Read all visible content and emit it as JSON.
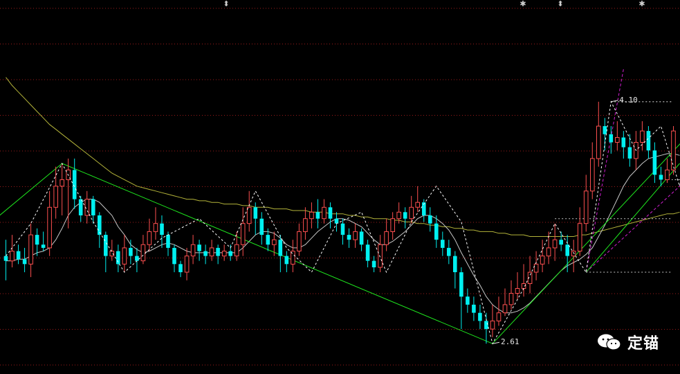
{
  "chart_data": {
    "type": "candlestick",
    "y_range": [
      2.5,
      4.3
    ],
    "labels": {
      "low": "2.61",
      "high": "4.10"
    },
    "candles": [
      [
        3.15,
        3.12,
        3.25,
        3.0
      ],
      [
        3.12,
        3.18,
        3.28,
        3.08
      ],
      [
        3.18,
        3.13,
        3.22,
        3.1
      ],
      [
        3.13,
        3.1,
        3.2,
        3.05
      ],
      [
        3.1,
        3.28,
        3.35,
        3.02
      ],
      [
        3.28,
        3.22,
        3.32,
        3.15
      ],
      [
        3.22,
        3.2,
        3.3,
        3.18
      ],
      [
        3.2,
        3.45,
        3.55,
        3.15
      ],
      [
        3.45,
        3.58,
        3.7,
        3.38
      ],
      [
        3.58,
        3.62,
        3.72,
        3.4
      ],
      [
        3.62,
        3.68,
        3.75,
        3.32
      ],
      [
        3.68,
        3.5,
        3.75,
        3.44
      ],
      [
        3.5,
        3.4,
        3.52,
        3.36
      ],
      [
        3.4,
        3.5,
        3.55,
        3.35
      ],
      [
        3.5,
        3.4,
        3.52,
        3.35
      ],
      [
        3.4,
        3.28,
        3.42,
        3.2
      ],
      [
        3.28,
        3.15,
        3.3,
        3.05
      ],
      [
        3.15,
        3.18,
        3.25,
        3.12
      ],
      [
        3.18,
        3.1,
        3.22,
        3.05
      ],
      [
        3.1,
        3.2,
        3.28,
        3.05
      ],
      [
        3.2,
        3.15,
        3.25,
        3.1
      ],
      [
        3.15,
        3.12,
        3.2,
        3.05
      ],
      [
        3.12,
        3.22,
        3.28,
        3.1
      ],
      [
        3.22,
        3.3,
        3.38,
        3.18
      ],
      [
        3.3,
        3.35,
        3.45,
        3.25
      ],
      [
        3.35,
        3.28,
        3.4,
        3.2
      ],
      [
        3.28,
        3.2,
        3.3,
        3.15
      ],
      [
        3.2,
        3.1,
        3.22,
        3.05
      ],
      [
        3.1,
        3.05,
        3.12,
        3.02
      ],
      [
        3.05,
        3.15,
        3.2,
        3.0
      ],
      [
        3.15,
        3.22,
        3.28,
        3.1
      ],
      [
        3.22,
        3.18,
        3.25,
        3.12
      ],
      [
        3.18,
        3.15,
        3.22,
        3.1
      ],
      [
        3.15,
        3.2,
        3.25,
        3.12
      ],
      [
        3.2,
        3.15,
        3.22,
        3.1
      ],
      [
        3.15,
        3.18,
        3.22,
        3.12
      ],
      [
        3.18,
        3.15,
        3.22,
        3.12
      ],
      [
        3.15,
        3.22,
        3.3,
        3.12
      ],
      [
        3.22,
        3.35,
        3.45,
        3.15
      ],
      [
        3.35,
        3.45,
        3.55,
        3.3
      ],
      [
        3.45,
        3.38,
        3.48,
        3.28
      ],
      [
        3.38,
        3.28,
        3.42,
        3.22
      ],
      [
        3.28,
        3.22,
        3.32,
        3.18
      ],
      [
        3.22,
        3.25,
        3.3,
        3.15
      ],
      [
        3.25,
        3.15,
        3.28,
        3.05
      ],
      [
        3.15,
        3.1,
        3.18,
        3.05
      ],
      [
        3.1,
        3.18,
        3.25,
        3.05
      ],
      [
        3.18,
        3.3,
        3.35,
        3.15
      ],
      [
        3.3,
        3.38,
        3.45,
        3.25
      ],
      [
        3.38,
        3.42,
        3.48,
        3.32
      ],
      [
        3.42,
        3.38,
        3.5,
        3.32
      ],
      [
        3.38,
        3.45,
        3.5,
        3.35
      ],
      [
        3.45,
        3.38,
        3.48,
        3.32
      ],
      [
        3.38,
        3.35,
        3.42,
        3.3
      ],
      [
        3.35,
        3.28,
        3.38,
        3.22
      ],
      [
        3.28,
        3.25,
        3.32,
        3.2
      ],
      [
        3.25,
        3.3,
        3.35,
        3.2
      ],
      [
        3.3,
        3.22,
        3.32,
        3.18
      ],
      [
        3.22,
        3.12,
        3.25,
        3.08
      ],
      [
        3.12,
        3.08,
        3.15,
        3.05
      ],
      [
        3.08,
        3.22,
        3.28,
        3.05
      ],
      [
        3.22,
        3.3,
        3.38,
        3.18
      ],
      [
        3.3,
        3.38,
        3.42,
        3.25
      ],
      [
        3.38,
        3.42,
        3.48,
        3.35
      ],
      [
        3.42,
        3.38,
        3.45,
        3.32
      ],
      [
        3.38,
        3.45,
        3.52,
        3.35
      ],
      [
        3.45,
        3.48,
        3.58,
        3.42
      ],
      [
        3.48,
        3.4,
        3.5,
        3.36
      ],
      [
        3.4,
        3.35,
        3.45,
        3.3
      ],
      [
        3.35,
        3.25,
        3.4,
        3.2
      ],
      [
        3.25,
        3.2,
        3.3,
        3.15
      ],
      [
        3.2,
        3.15,
        3.25,
        3.1
      ],
      [
        3.15,
        3.05,
        3.18,
        2.95
      ],
      [
        3.05,
        2.9,
        3.08,
        2.7
      ],
      [
        2.9,
        2.85,
        2.95,
        2.8
      ],
      [
        2.85,
        2.8,
        2.9,
        2.75
      ],
      [
        2.8,
        2.75,
        2.85,
        2.7
      ],
      [
        2.75,
        2.7,
        2.8,
        2.61
      ],
      [
        2.7,
        2.75,
        2.85,
        2.65
      ],
      [
        2.75,
        2.8,
        2.9,
        2.72
      ],
      [
        2.8,
        2.85,
        2.95,
        2.78
      ],
      [
        2.85,
        2.92,
        3.0,
        2.82
      ],
      [
        2.92,
        2.95,
        3.05,
        2.88
      ],
      [
        2.95,
        2.98,
        3.1,
        2.9
      ],
      [
        2.98,
        3.05,
        3.15,
        2.92
      ],
      [
        3.05,
        3.1,
        3.18,
        3.0
      ],
      [
        3.1,
        3.15,
        3.25,
        3.05
      ],
      [
        3.15,
        3.2,
        3.3,
        3.1
      ],
      [
        3.2,
        3.25,
        3.35,
        3.12
      ],
      [
        3.25,
        3.22,
        3.3,
        3.18
      ],
      [
        3.22,
        3.15,
        3.28,
        3.05
      ],
      [
        3.15,
        3.18,
        3.25,
        3.05
      ],
      [
        3.18,
        3.35,
        3.45,
        3.15
      ],
      [
        3.35,
        3.55,
        3.65,
        3.3
      ],
      [
        3.55,
        3.75,
        3.85,
        3.5
      ],
      [
        3.75,
        3.95,
        4.1,
        3.7
      ],
      [
        3.95,
        3.9,
        4.0,
        3.8
      ],
      [
        3.9,
        3.85,
        3.95,
        3.78
      ],
      [
        3.85,
        3.88,
        3.98,
        3.8
      ],
      [
        3.88,
        3.82,
        3.92,
        3.75
      ],
      [
        3.82,
        3.75,
        3.9,
        3.7
      ],
      [
        3.75,
        3.85,
        3.92,
        3.68
      ],
      [
        3.85,
        3.92,
        3.98,
        3.8
      ],
      [
        3.92,
        3.8,
        3.95,
        3.75
      ],
      [
        3.8,
        3.65,
        3.85,
        3.6
      ],
      [
        3.65,
        3.62,
        3.7,
        3.58
      ],
      [
        3.62,
        3.68,
        3.75,
        3.6
      ],
      [
        3.68,
        3.92,
        3.95,
        3.65
      ]
    ],
    "ma_short": [
      3.12,
      3.12,
      3.13,
      3.13,
      3.15,
      3.17,
      3.18,
      3.2,
      3.25,
      3.32,
      3.4,
      3.45,
      3.48,
      3.5,
      3.5,
      3.48,
      3.44,
      3.4,
      3.33,
      3.28,
      3.22,
      3.19,
      3.17,
      3.18,
      3.2,
      3.22,
      3.23,
      3.22,
      3.2,
      3.18,
      3.17,
      3.17,
      3.17,
      3.17,
      3.17,
      3.17,
      3.17,
      3.17,
      3.2,
      3.24,
      3.28,
      3.3,
      3.3,
      3.29,
      3.26,
      3.22,
      3.2,
      3.2,
      3.22,
      3.26,
      3.3,
      3.33,
      3.36,
      3.38,
      3.38,
      3.37,
      3.35,
      3.33,
      3.29,
      3.25,
      3.22,
      3.22,
      3.24,
      3.27,
      3.3,
      3.34,
      3.38,
      3.4,
      3.4,
      3.38,
      3.35,
      3.31,
      3.25,
      3.17,
      3.1,
      3.03,
      2.97,
      2.9,
      2.85,
      2.82,
      2.8,
      2.8,
      2.81,
      2.83,
      2.86,
      2.9,
      2.94,
      2.98,
      3.02,
      3.06,
      3.09,
      3.11,
      3.13,
      3.16,
      3.2,
      3.27,
      3.34,
      3.42,
      3.5,
      3.58,
      3.64,
      3.68,
      3.72,
      3.75,
      3.76,
      3.77,
      3.78,
      3.78,
      3.77
    ],
    "ma_long": [
      4.25,
      4.2,
      4.16,
      4.12,
      4.08,
      4.04,
      4.0,
      3.96,
      3.93,
      3.9,
      3.87,
      3.84,
      3.81,
      3.78,
      3.75,
      3.72,
      3.69,
      3.66,
      3.64,
      3.62,
      3.6,
      3.58,
      3.57,
      3.56,
      3.55,
      3.54,
      3.53,
      3.52,
      3.51,
      3.5,
      3.5,
      3.49,
      3.49,
      3.48,
      3.48,
      3.47,
      3.47,
      3.47,
      3.46,
      3.46,
      3.45,
      3.45,
      3.45,
      3.44,
      3.44,
      3.44,
      3.43,
      3.43,
      3.43,
      3.42,
      3.42,
      3.42,
      3.41,
      3.41,
      3.41,
      3.4,
      3.4,
      3.39,
      3.39,
      3.38,
      3.38,
      3.38,
      3.37,
      3.37,
      3.36,
      3.36,
      3.35,
      3.35,
      3.34,
      3.34,
      3.33,
      3.33,
      3.32,
      3.32,
      3.31,
      3.31,
      3.3,
      3.3,
      3.3,
      3.29,
      3.29,
      3.28,
      3.28,
      3.28,
      3.27,
      3.27,
      3.27,
      3.27,
      3.27,
      3.27,
      3.27,
      3.27,
      3.28,
      3.28,
      3.29,
      3.3,
      3.31,
      3.32,
      3.33,
      3.34,
      3.35,
      3.36,
      3.37,
      3.38,
      3.39,
      3.4,
      3.41,
      3.41,
      3.42
    ],
    "zigzag": [
      [
        0,
        3.15
      ],
      [
        4,
        3.35
      ],
      [
        9,
        3.72
      ],
      [
        14,
        3.36
      ],
      [
        19,
        3.05
      ],
      [
        25,
        3.26
      ],
      [
        31,
        3.38
      ],
      [
        36,
        3.2
      ],
      [
        40,
        3.55
      ],
      [
        45,
        3.2
      ],
      [
        49,
        3.05
      ],
      [
        53,
        3.35
      ],
      [
        57,
        3.42
      ],
      [
        61,
        3.05
      ],
      [
        65,
        3.36
      ],
      [
        69,
        3.58
      ],
      [
        73,
        3.36
      ],
      [
        78,
        2.61
      ],
      [
        83,
        2.95
      ],
      [
        88,
        3.35
      ],
      [
        93,
        3.05
      ],
      [
        97,
        4.1
      ],
      [
        101,
        3.8
      ],
      [
        105,
        3.95
      ],
      [
        108,
        3.58
      ],
      [
        110,
        3.92
      ]
    ],
    "trendlines": [
      {
        "color": "#1ee61e",
        "dash": false,
        "points": [
          [
            -1,
            3.4
          ],
          [
            9,
            3.72
          ],
          [
            78,
            2.61
          ],
          [
            110,
            3.92
          ]
        ]
      },
      {
        "color": "#d21ed2",
        "dash": true,
        "points": [
          [
            93,
            3.05
          ],
          [
            99,
            4.3
          ]
        ]
      },
      {
        "color": "#d21ed2",
        "dash": true,
        "points": [
          [
            93,
            3.05
          ],
          [
            110,
            3.65
          ]
        ]
      },
      {
        "color": "#1ee61e",
        "dash": false,
        "points": [
          [
            93,
            3.05
          ],
          [
            108,
            3.72
          ]
        ]
      }
    ],
    "support_levels": [
      {
        "price": 4.1,
        "from": 97,
        "to": 111,
        "color": "#e6e6e6"
      },
      {
        "price": 3.62,
        "from": 108,
        "to": 111,
        "color": "#e6e6e6"
      },
      {
        "price": 3.38,
        "from": 88,
        "to": 111,
        "color": "#c8c8c8"
      },
      {
        "price": 3.05,
        "from": 93,
        "to": 111,
        "color": "#c8c8c8"
      }
    ],
    "colors": {
      "up": "#ff5050",
      "down": "#00f0f0",
      "ma_short": "#c8c8c8",
      "ma_long": "#b4b43a",
      "zigzag": "#ffffff",
      "grid": "#9e1b1b"
    }
  },
  "top_icons": [
    "⬍",
    "✱",
    "⬍",
    "✱"
  ],
  "watermark": {
    "icon": "wechat-icon",
    "text": "定锚"
  }
}
